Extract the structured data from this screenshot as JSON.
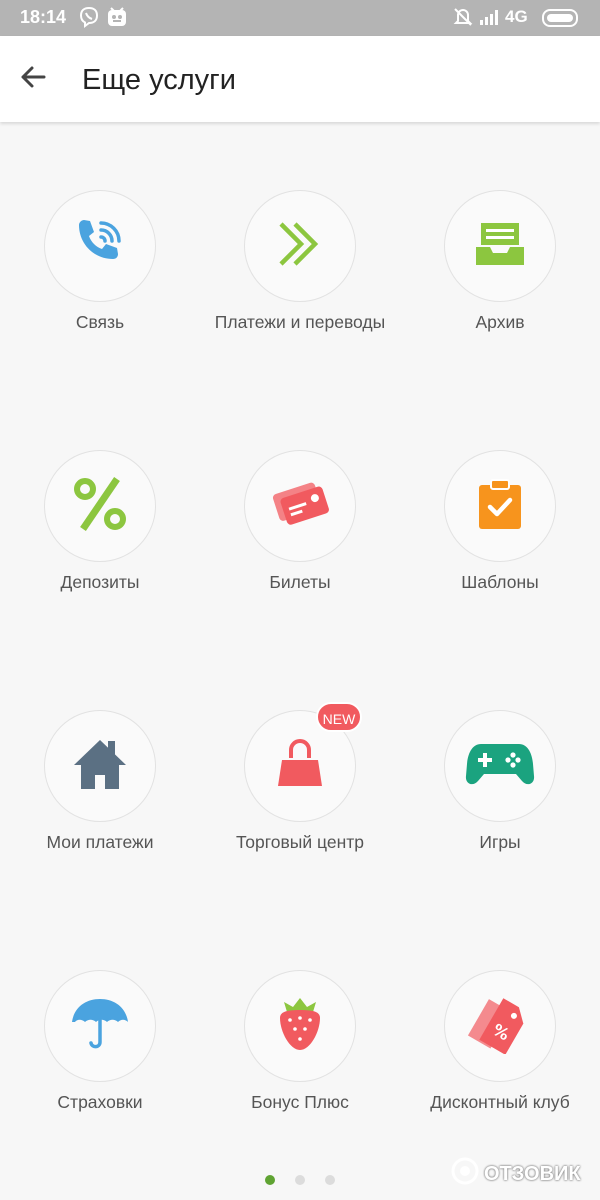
{
  "status_bar": {
    "time": "18:14",
    "network": "4G",
    "icons": [
      "viber-icon",
      "app-notification-icon",
      "mute-icon",
      "signal-icon",
      "battery-icon"
    ]
  },
  "header": {
    "title": "Еще услуги",
    "back_icon": "arrow-left-icon"
  },
  "services": [
    {
      "label": "Связь",
      "icon": "phone-icon",
      "color": "#4aa3df"
    },
    {
      "label": "Платежи и переводы",
      "icon": "double-chevron-icon",
      "color": "#8cc63f"
    },
    {
      "label": "Архив",
      "icon": "archive-tray-icon",
      "color": "#8cc63f"
    },
    {
      "label": "Депозиты",
      "icon": "percent-icon",
      "color": "#8cc63f"
    },
    {
      "label": "Билеты",
      "icon": "tickets-icon",
      "color": "#f15a5f"
    },
    {
      "label": "Шаблоны",
      "icon": "clipboard-check-icon",
      "color": "#f7941d"
    },
    {
      "label": "Мои платежи",
      "icon": "house-icon",
      "color": "#5b7083"
    },
    {
      "label": "Торговый центр",
      "icon": "shopping-bag-icon",
      "color": "#f15a5f",
      "badge": "NEW"
    },
    {
      "label": "Игры",
      "icon": "gamepad-icon",
      "color": "#1ba37f"
    },
    {
      "label": "Страховки",
      "icon": "umbrella-icon",
      "color": "#4aa3df"
    },
    {
      "label": "Бонус Плюс",
      "icon": "strawberry-icon",
      "color": "#f15a5f"
    },
    {
      "label": "Дисконтный клуб",
      "icon": "discount-tag-icon",
      "color": "#f15a5f"
    }
  ],
  "pager": {
    "pages": 3,
    "active": 1,
    "active_color": "#5fa332"
  },
  "watermark": {
    "text": "ОТЗОВИК"
  }
}
